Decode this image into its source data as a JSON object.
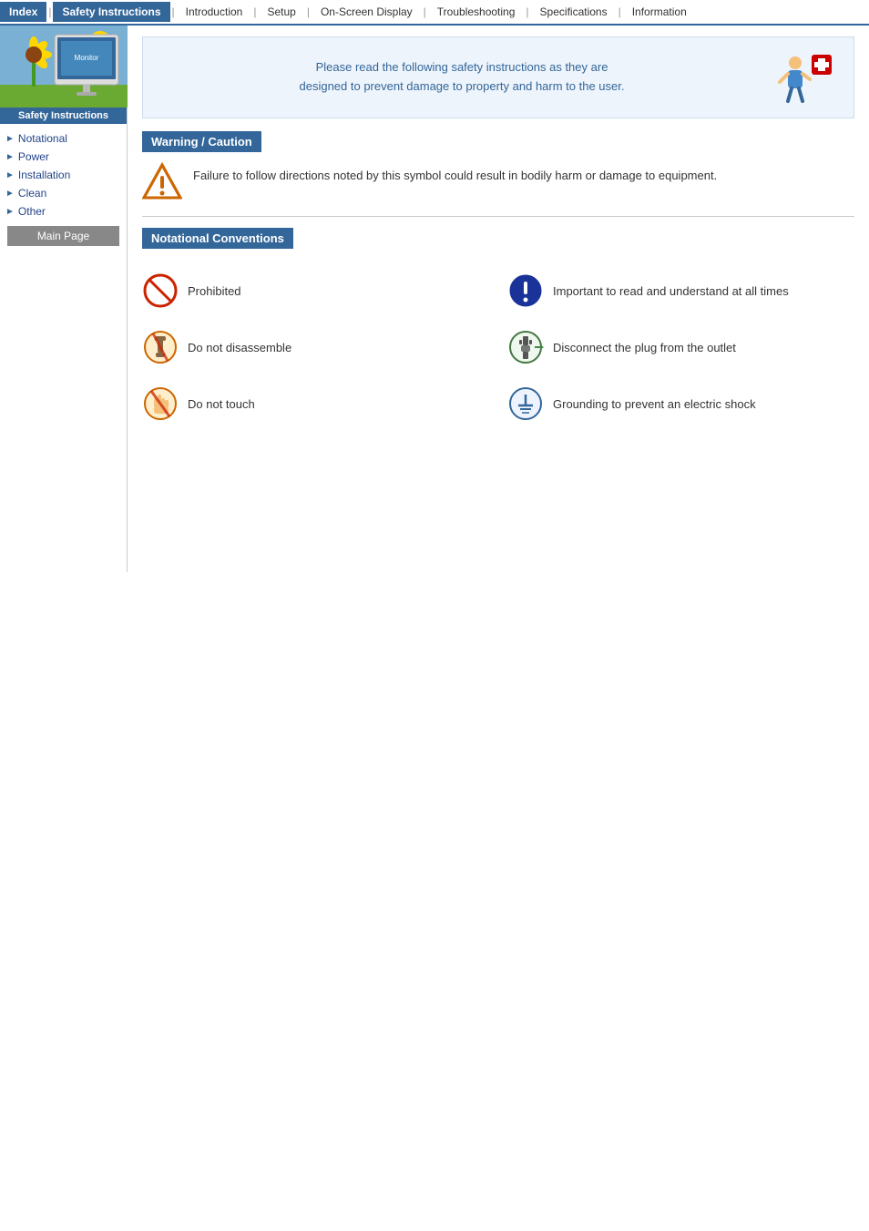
{
  "navbar": {
    "items": [
      {
        "label": "Index",
        "active": false
      },
      {
        "label": "Safety Instructions",
        "active": true
      },
      {
        "label": "Introduction",
        "active": false
      },
      {
        "label": "Setup",
        "active": false
      },
      {
        "label": "On-Screen Display",
        "active": false
      },
      {
        "label": "Troubleshooting",
        "active": false
      },
      {
        "label": "Specifications",
        "active": false
      },
      {
        "label": "Information",
        "active": false
      }
    ]
  },
  "sidebar": {
    "label": "Safety Instructions",
    "nav_items": [
      {
        "label": "Notational"
      },
      {
        "label": "Power"
      },
      {
        "label": "Installation"
      },
      {
        "label": "Clean"
      },
      {
        "label": "Other"
      }
    ],
    "main_page": "Main Page"
  },
  "intro": {
    "text_line1": "Please read the following safety instructions as they are",
    "text_line2": "designed to prevent damage to property and harm to the user."
  },
  "warning_section": {
    "header": "Warning / Caution",
    "text": "Failure to follow directions noted by this symbol could result in bodily harm or damage to equipment."
  },
  "notational": {
    "header": "Notational Conventions",
    "items": [
      {
        "label": "Prohibited",
        "description": "",
        "side": "left"
      },
      {
        "label": "Important to read and understand at all times",
        "description": "",
        "side": "right"
      },
      {
        "label": "Do not disassemble",
        "description": "",
        "side": "left"
      },
      {
        "label": "Disconnect the plug from the outlet",
        "description": "",
        "side": "right"
      },
      {
        "label": "Do not touch",
        "description": "",
        "side": "left"
      },
      {
        "label": "Grounding to prevent an electric shock",
        "description": "",
        "side": "right"
      }
    ]
  }
}
